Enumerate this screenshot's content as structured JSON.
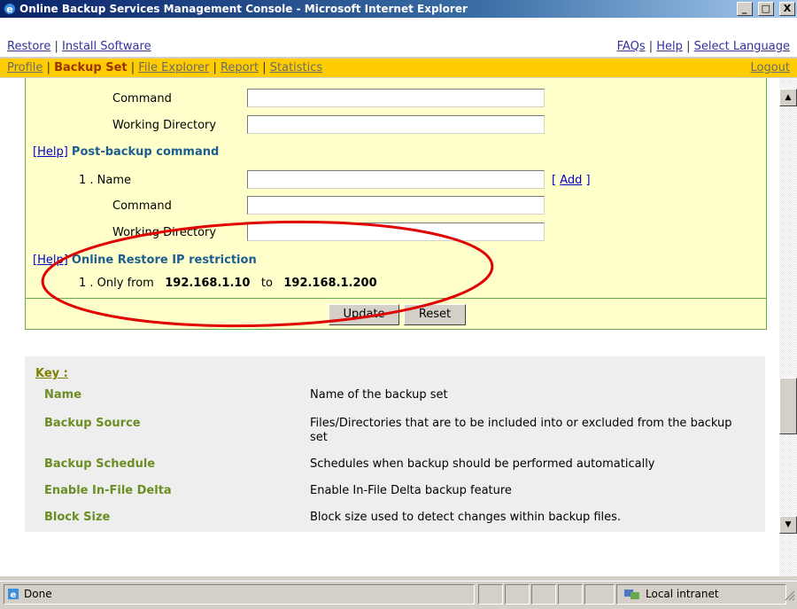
{
  "window": {
    "title": "Online Backup Services Management Console - Microsoft Internet Explorer",
    "min_label": "_",
    "max_label": "□",
    "close_label": "X"
  },
  "nav_top": {
    "restore": "Restore",
    "sep1": "|",
    "install": "Install Software",
    "faqs": "FAQs",
    "sep2": "|",
    "help": "Help",
    "sep3": "|",
    "language": "Select Language"
  },
  "nav_main": {
    "profile": "Profile",
    "backup_set": "Backup Set",
    "file_explorer": "File Explorer",
    "report": "Report",
    "statistics": "Statistics",
    "sep": "|",
    "logout": "Logout"
  },
  "form": {
    "pre_command_label": "Command",
    "pre_workdir_label": "Working Directory",
    "post_help": "[Help]",
    "post_title": "Post-backup command",
    "post_index": "1 . Name",
    "post_add": "[ Add ]",
    "post_add_link": "Add",
    "post_command_label": "Command",
    "post_workdir_label": "Working Directory",
    "ip_help": "[Help]",
    "ip_title": "Online Restore IP restriction",
    "ip_index": "1 . Only from",
    "ip_from": "192.168.1.10",
    "ip_to_word": "to",
    "ip_to": "192.168.1.200",
    "update_label": "Update",
    "reset_label": "Reset"
  },
  "key": {
    "heading": "Key :",
    "rows": [
      {
        "name": "Name",
        "desc": "Name of the backup set"
      },
      {
        "name": "Backup Source",
        "desc": "Files/Directories that are to be included into or excluded from the backup set"
      },
      {
        "name": "Backup Schedule",
        "desc": "Schedules when backup should be performed automatically"
      },
      {
        "name": "Enable In-File Delta",
        "desc": "Enable In-File Delta backup feature"
      },
      {
        "name": "Block Size",
        "desc": "Block size used to detect changes within backup files."
      }
    ]
  },
  "status": {
    "text": "Done",
    "zone": "Local intranet"
  },
  "colors": {
    "nav_bar": "#ffcc00",
    "panel_bg": "#ffffcc",
    "annotation": "#e00000"
  }
}
